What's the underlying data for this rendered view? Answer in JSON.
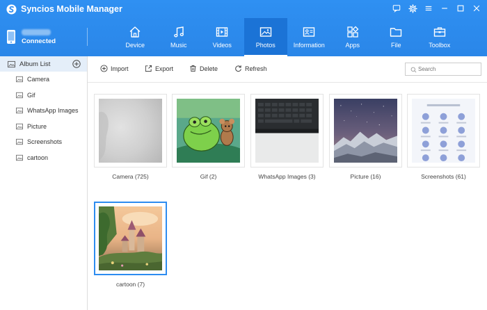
{
  "app": {
    "title": "Syncios Mobile Manager"
  },
  "device": {
    "status": "Connected"
  },
  "tabs": [
    {
      "label": "Device",
      "icon": "home-icon"
    },
    {
      "label": "Music",
      "icon": "music-icon"
    },
    {
      "label": "Videos",
      "icon": "film-icon"
    },
    {
      "label": "Photos",
      "icon": "photo-icon",
      "active": true
    },
    {
      "label": "Information",
      "icon": "contact-card-icon"
    },
    {
      "label": "Apps",
      "icon": "apps-grid-icon"
    },
    {
      "label": "File",
      "icon": "folder-icon"
    },
    {
      "label": "Toolbox",
      "icon": "toolbox-icon"
    }
  ],
  "sidebar": {
    "header": "Album List",
    "items": [
      {
        "label": "Camera"
      },
      {
        "label": "Gif"
      },
      {
        "label": "WhatsApp Images"
      },
      {
        "label": "Picture"
      },
      {
        "label": "Screenshots"
      },
      {
        "label": "cartoon"
      }
    ]
  },
  "toolbar": {
    "import": "Import",
    "export": "Export",
    "delete": "Delete",
    "refresh": "Refresh",
    "search_placeholder": "Search"
  },
  "albums": [
    {
      "caption": "Camera (725)"
    },
    {
      "caption": "Gif (2)"
    },
    {
      "caption": "WhatsApp Images (3)"
    },
    {
      "caption": "Picture (16)"
    },
    {
      "caption": "Screenshots (61)"
    },
    {
      "caption": "cartoon (7)",
      "selected": true
    }
  ],
  "colors": {
    "header_blue": "#2d8cf0",
    "active_tab": "#1b73d6",
    "sidebar_highlight": "#e4eef9"
  }
}
